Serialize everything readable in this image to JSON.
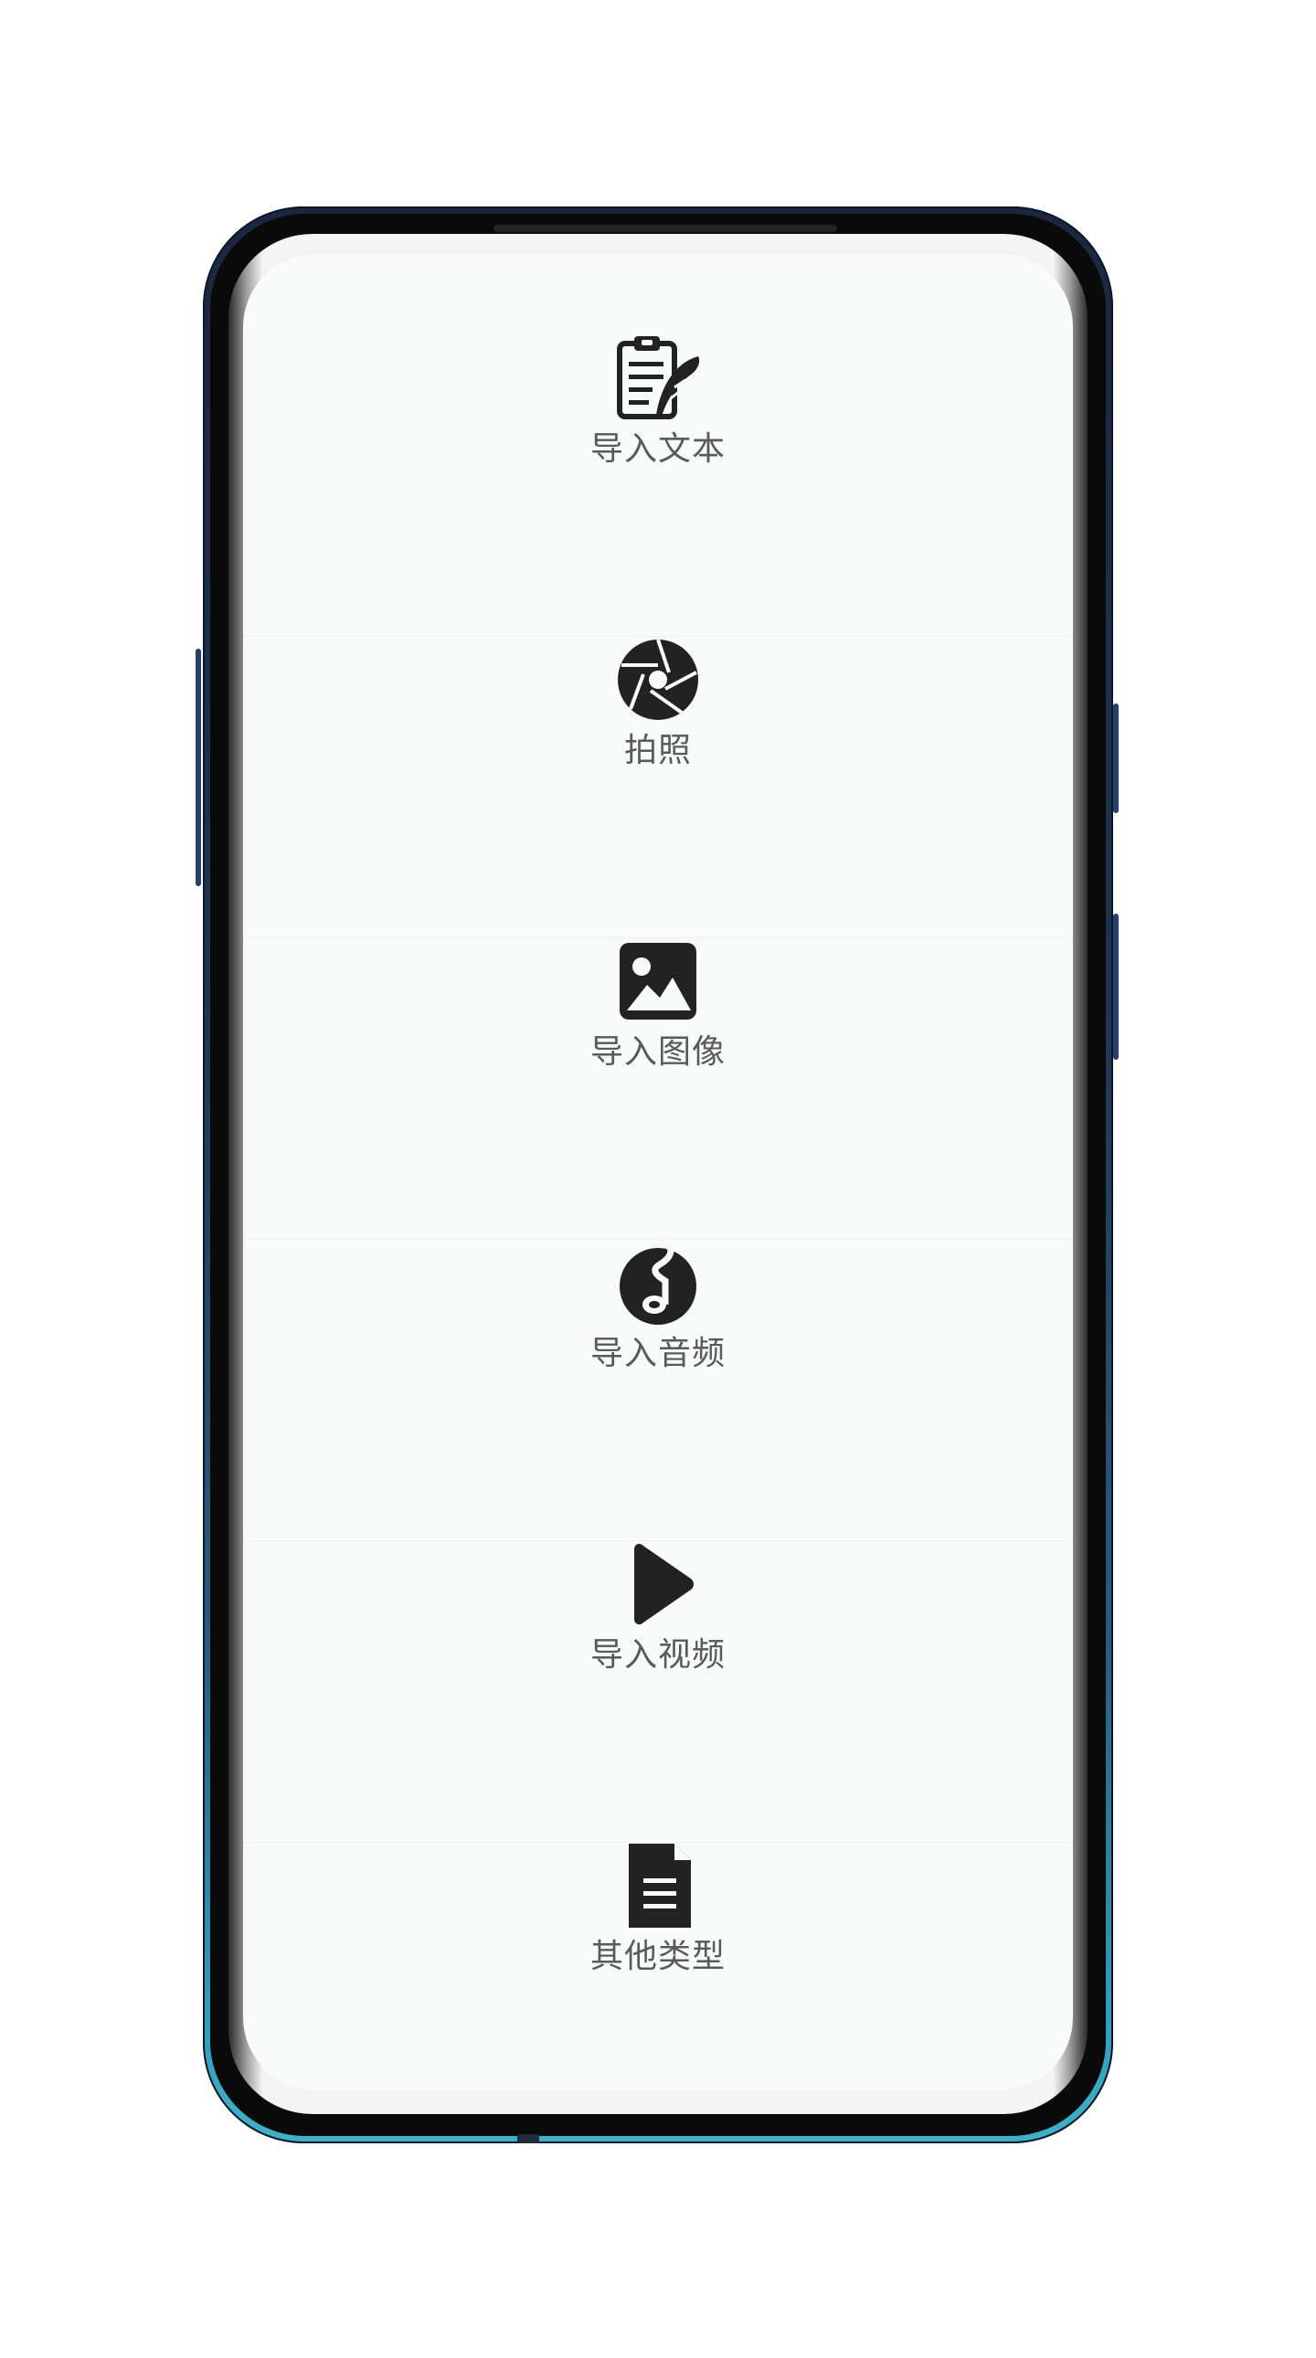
{
  "menu": {
    "items": [
      {
        "label": "导入文本",
        "icon": "clipboard-quill-icon"
      },
      {
        "label": "拍照",
        "icon": "camera-aperture-icon"
      },
      {
        "label": "导入图像",
        "icon": "image-icon"
      },
      {
        "label": "导入音频",
        "icon": "music-note-icon"
      },
      {
        "label": "导入视频",
        "icon": "play-icon"
      },
      {
        "label": "其他类型",
        "icon": "document-icon"
      }
    ]
  },
  "colors": {
    "icon": "#222222",
    "label": "#5a5a5a",
    "screen_background": "#f9fafa"
  }
}
